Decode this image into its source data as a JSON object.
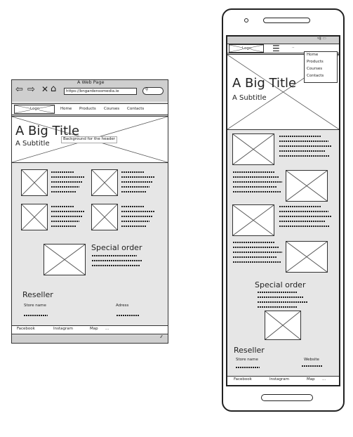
{
  "browser": {
    "window_title": "A Web Page",
    "url": "https://bngardenssmedia.ie",
    "search_icon": "search-icon"
  },
  "nav": {
    "logo": "Logo",
    "items": [
      "Home",
      "Products",
      "Courses",
      "Contacts"
    ]
  },
  "hero": {
    "title": "A Big Title",
    "subtitle": "A Subtitle",
    "note": "Background for the header"
  },
  "special": {
    "title": "Special order"
  },
  "reseller": {
    "title": "Reseller",
    "col_store": "Store name",
    "col_address": "Adress",
    "col_website": "Website"
  },
  "footer": {
    "items": [
      "Facebook",
      "Instagram",
      "Map",
      "..."
    ]
  },
  "mobile": {
    "logo": "Logo",
    "menu_extra": "..",
    "dropdown": [
      "Home",
      "Products",
      "Courses",
      "Contacts"
    ],
    "title": "A Big Title",
    "subtitle": "A Subtitle",
    "special": "Special order",
    "reseller": "Reseller",
    "col_store": "Store name",
    "col_website": "Website",
    "footer": [
      "Facebook",
      "Instagram",
      "Map",
      "..."
    ]
  }
}
